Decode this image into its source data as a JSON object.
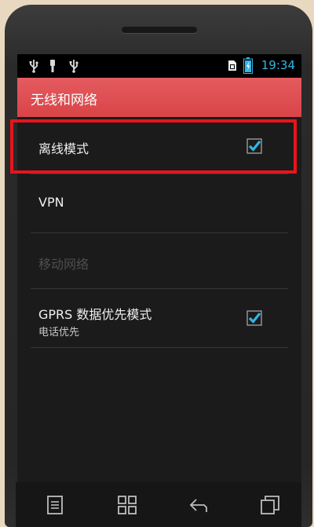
{
  "status_bar": {
    "time": "19:34",
    "accent_color": "#33b5e5",
    "icons": [
      "usb-icon",
      "usb-icon",
      "usb-icon",
      "sim-icon",
      "battery-icon"
    ]
  },
  "action_bar": {
    "title": "无线和网络",
    "color": "#dd4a4e"
  },
  "preferences": [
    {
      "title": "离线模式",
      "summary": "",
      "enabled": true,
      "checked": true
    },
    {
      "title": "VPN",
      "summary": "",
      "enabled": true
    },
    {
      "title": "移动网络",
      "summary": "",
      "enabled": false
    },
    {
      "title": "GPRS 数据优先模式",
      "summary": "电话优先",
      "enabled": true,
      "checked": true
    }
  ],
  "highlight_color": "#e8141c",
  "nav_bar": {
    "buttons": [
      "menu-icon",
      "apps-icon",
      "back-icon",
      "recent-apps-icon"
    ]
  }
}
